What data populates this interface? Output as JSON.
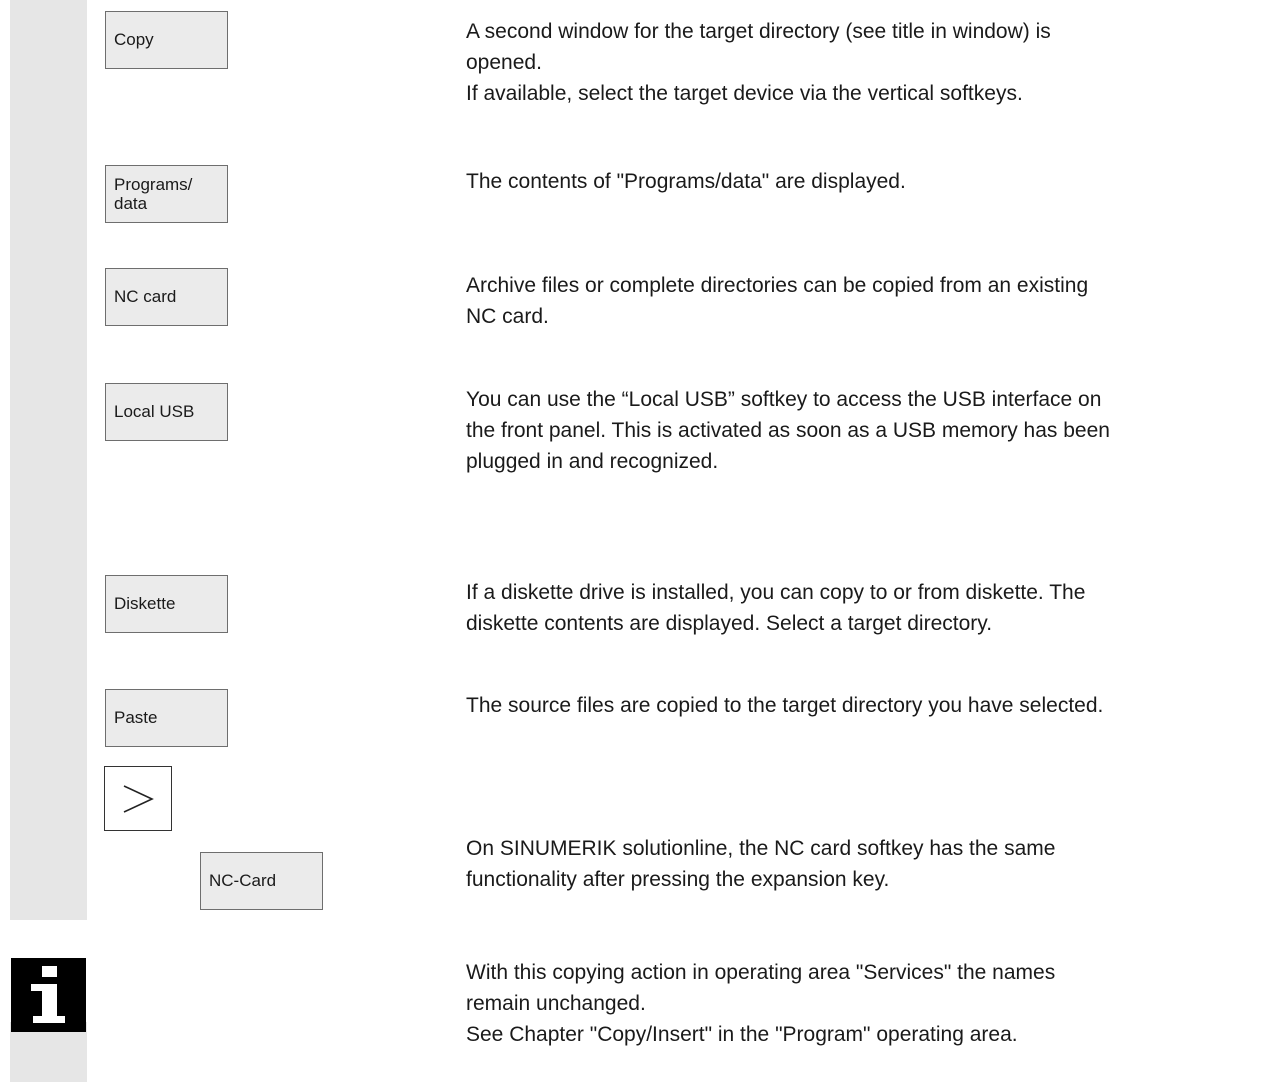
{
  "softkeys": {
    "copy": "Copy",
    "programs_data_line1": "Programs/",
    "programs_data_line2": "data",
    "nc_card": "NC card",
    "local_usb": "Local USB",
    "diskette": "Diskette",
    "paste": "Paste",
    "nc_card_2": "NC-Card"
  },
  "descriptions": {
    "copy": [
      "A second window for the target directory (see title in window) is",
      "opened.",
      "If available, select the target device via the vertical softkeys."
    ],
    "programs_data": [
      "The contents of \"Programs/data\" are displayed."
    ],
    "nc_card": [
      "Archive files or complete directories can be copied from an existing",
      "NC card."
    ],
    "local_usb": [
      "You can use the “Local USB” softkey to access the USB interface on",
      "the front panel. This is activated as soon as a USB memory has been",
      "plugged in and recognized."
    ],
    "diskette": [
      "If a diskette drive is installed, you can copy to or from diskette. The",
      "diskette contents are displayed. Select a target directory."
    ],
    "paste": [
      "The source files are copied to the target directory you have selected."
    ],
    "solutionline": [
      "On SINUMERIK solutionline, the NC card softkey has the same",
      "functionality after pressing the expansion key."
    ]
  },
  "note": {
    "icon": "info-icon",
    "lines": [
      "With this copying action in operating area \"Services\" the names",
      "remain unchanged.",
      "See Chapter \"Copy/Insert\" in the \"Program\" operating area."
    ]
  },
  "colors": {
    "bar": "#e6e6e6",
    "softkey_bg": "#ebebeb",
    "icon_black": "#000000"
  }
}
